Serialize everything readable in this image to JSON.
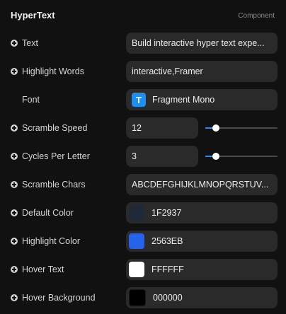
{
  "header": {
    "title": "HyperText",
    "subtitle": "Component"
  },
  "properties": {
    "text": {
      "label": "Text",
      "value": "Build interactive hyper text expe..."
    },
    "highlight_words": {
      "label": "Highlight Words",
      "value": "interactive,Framer"
    },
    "font": {
      "label": "Font",
      "value": "Fragment Mono",
      "badge": "T",
      "badge_color": "#1F8EF1"
    },
    "scramble_speed": {
      "label": "Scramble Speed",
      "value": "12",
      "slider_level": 0.15
    },
    "cycles_per_letter": {
      "label": "Cycles Per Letter",
      "value": "3",
      "slider_level": 0.15
    },
    "scramble_chars": {
      "label": "Scramble Chars",
      "value": "ABCDEFGHIJKLMNOPQRSTUV..."
    },
    "default_color": {
      "label": "Default Color",
      "value": "1F2937",
      "color": "#1F2937"
    },
    "highlight_color": {
      "label": "Highlight Color",
      "value": "2563EB",
      "color": "#2563EB"
    },
    "hover_text": {
      "label": "Hover Text",
      "value": "FFFFFF",
      "color": "#FFFFFF"
    },
    "hover_background": {
      "label": "Hover Background",
      "value": "000000",
      "color": "#000000"
    }
  },
  "accent_color": "#1F8EF1"
}
